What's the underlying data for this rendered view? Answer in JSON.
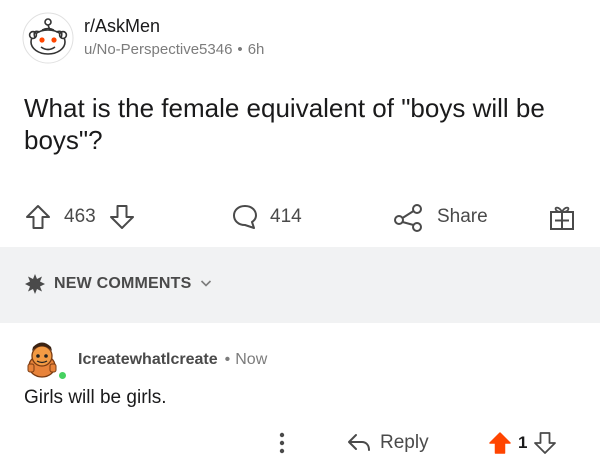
{
  "post": {
    "subreddit": "r/AskMen",
    "author": "u/No-Perspective5346",
    "separator": "•",
    "age": "6h",
    "title": "What is the female equivalent of \"boys will be boys\"?"
  },
  "actions": {
    "upvotes": "463",
    "comments": "414",
    "share_label": "Share"
  },
  "comments_section": {
    "sort_label": "NEW COMMENTS"
  },
  "comment": {
    "author": "Icreatewhatlcreate",
    "separator": "•",
    "age": "Now",
    "body": "Girls will be girls.",
    "reply_label": "Reply",
    "score": "1"
  },
  "colors": {
    "upvote_active": "#ff4500",
    "online": "#46d160",
    "band": "#f1f2f3",
    "muted_text": "#7c7c7c"
  },
  "icons": [
    "snoo-avatar",
    "upvote-icon",
    "downvote-icon",
    "comment-icon",
    "share-icon",
    "award-icon",
    "sort-icon",
    "chevron-down-icon",
    "more-icon",
    "reply-icon"
  ]
}
